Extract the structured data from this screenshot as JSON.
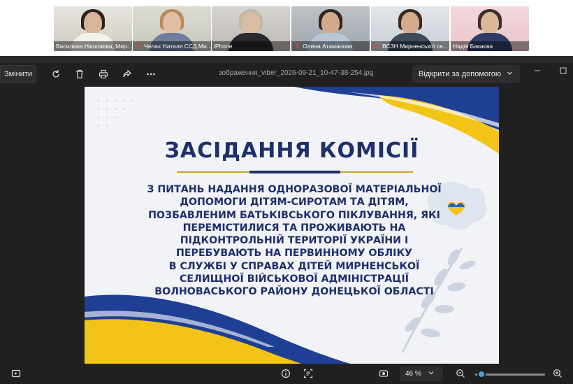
{
  "participants": [
    {
      "name": "Василина Ніколаєва, Мир...",
      "mic_off": false,
      "active": false
    },
    {
      "name": "Челах Наталя ССД Ми...",
      "mic_off": true,
      "active": false
    },
    {
      "name": "iPhone",
      "mic_off": false,
      "active": true
    },
    {
      "name": "Олена Атаманова",
      "mic_off": true,
      "active": false
    },
    {
      "name": "ВСЗН Мирненської се...",
      "mic_off": true,
      "active": false
    },
    {
      "name": "Надія Бакаєва",
      "mic_off": false,
      "active": false
    }
  ],
  "toolbar": {
    "edit_label": "Змінити",
    "filename": "зображення_viber_2026-09-21_10-47-38-254.jpg",
    "open_with_label": "Відкрити за допомогою",
    "icons": [
      "rotate-icon",
      "delete-icon",
      "print-icon",
      "share-icon",
      "more-icon"
    ]
  },
  "slide": {
    "title": "ЗАСІДАННЯ КОМІСІЇ",
    "body_lines": [
      "З ПИТАНЬ НАДАННЯ ОДНОРАЗОВОЇ МАТЕРІАЛЬНОЇ",
      "ДОПОМОГИ ДІТЯМ-СИРОТАМ ТА ДІТЯМ,",
      "ПОЗБАВЛЕНИМ БАТЬКІВСЬКОГО ПІКЛУВАННЯ, ЯКІ",
      "ПЕРЕМІСТИЛИСЯ ТА ПРОЖИВАЮТЬ НА",
      "ПІДКОНТРОЛЬНІЙ ТЕРИТОРІЇ УКРАЇНИ І",
      "ПЕРЕБУВАЮТЬ НА ПЕРВИННОМУ ОБЛІКУ",
      "В СЛУЖБІ У СПРАВАХ ДІТЕЙ МИРНЕНСЬКОЇ",
      "СЕЛИЩНОЇ ВІЙСЬКОВОЇ АДМІНІСТРАЦІЇ",
      "ВОЛНОВАСЬКОГО РАЙОНУ ДОНЕЦЬКОЇ ОБЛАСТІ"
    ],
    "colors": {
      "navy": "#1f2f6b",
      "blue": "#2f5fb3",
      "yellow": "#f2c417"
    }
  },
  "statusbar": {
    "zoom_label": "46 %",
    "zoom_level_fraction": 0.09,
    "icons": [
      "filmstrip-icon",
      "info-icon",
      "text-select-icon",
      "fit-screen-icon",
      "zoom-out-icon",
      "zoom-in-icon"
    ]
  }
}
